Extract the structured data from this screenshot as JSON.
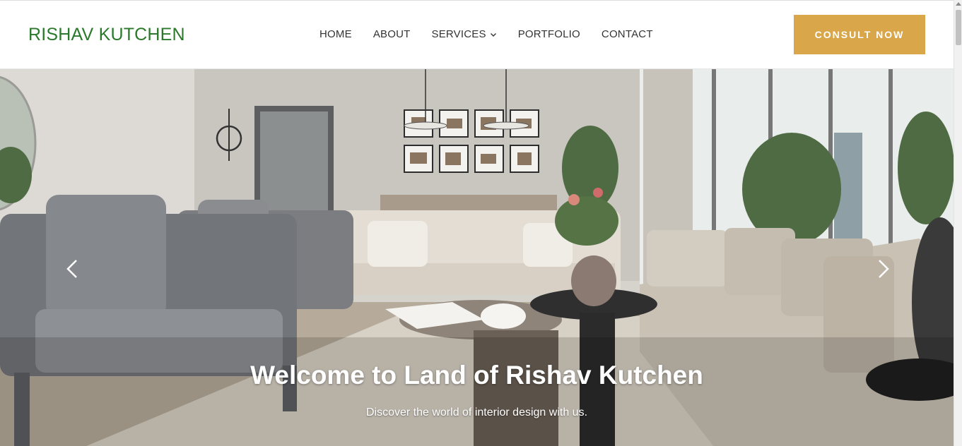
{
  "brand": {
    "name": "RISHAV KUTCHEN",
    "color": "#2b7a2b"
  },
  "nav": {
    "items": [
      {
        "label": "HOME"
      },
      {
        "label": "ABOUT"
      },
      {
        "label": "SERVICES",
        "icon": "chevron-down-icon"
      },
      {
        "label": "PORTFOLIO"
      },
      {
        "label": "CONTACT"
      }
    ]
  },
  "cta": {
    "label": "CONSULT NOW",
    "color": "#d9a64a"
  },
  "hero": {
    "title": "Welcome to Land of Rishav Kutchen",
    "subtitle": "Discover the world of interior design with us.",
    "prev_icon": "chevron-left-icon",
    "next_icon": "chevron-right-icon",
    "image": "living-room-photo"
  }
}
